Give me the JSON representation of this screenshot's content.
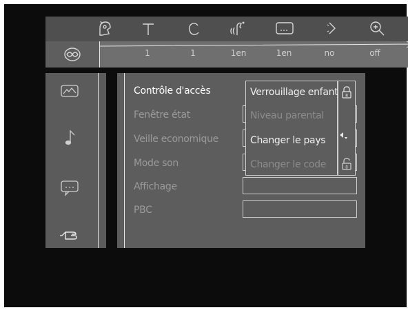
{
  "top_icons": [
    "audio-angle-icon",
    "title-icon",
    "chapter-icon",
    "audio-language-icon",
    "subtitle-icon",
    "angle-icon",
    "zoom-icon"
  ],
  "values_bar": {
    "disc_icon": "disc-icon",
    "values": [
      "1",
      "1",
      "1en",
      "1en",
      "no",
      "off"
    ]
  },
  "categories": [
    "picture-settings-icon",
    "sound-icon",
    "language-icon",
    "features-icon"
  ],
  "menu": {
    "items": [
      {
        "label": "Contrôle d'accès"
      },
      {
        "label": "Fenêtre état"
      },
      {
        "label": "Veille economique"
      },
      {
        "label": "Mode son"
      },
      {
        "label": "Affichage"
      },
      {
        "label": "PBC"
      }
    ]
  },
  "submenu": {
    "items": [
      {
        "label": "Verrouillage enfant"
      },
      {
        "label": "Niveau parental"
      },
      {
        "label": "Changer le pays"
      },
      {
        "label": "Changer le code"
      }
    ],
    "lock_icons": [
      "locked-icon",
      "unlocked-icon"
    ]
  },
  "colors": {
    "background": "#0c0c0c",
    "icon_bar": "#4f4f4f",
    "value_bar": "#6f6f6f",
    "panel": "#5d5d5d",
    "text_active": "#ffffff",
    "text_inactive": "#9a9a9a"
  }
}
